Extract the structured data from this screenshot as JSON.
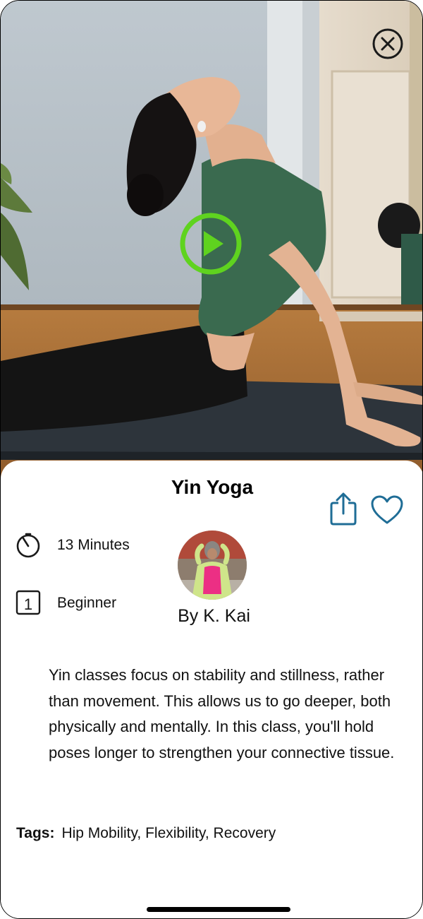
{
  "hero": {
    "close_icon": "close-circle-icon",
    "play_icon": "play-circle-icon",
    "accent_color": "#5fd31f"
  },
  "class": {
    "title": "Yin Yoga",
    "duration": "13 Minutes",
    "level_number": "1",
    "level": "Beginner",
    "instructor": "By K. Kai",
    "description": "Yin classes focus on stability and stillness, rather than movement. This allows us to go deeper, both physically and mentally. In this class, you'll hold poses longer to strengthen your connective tissue.",
    "tags_label": "Tags:",
    "tags": "Hip Mobility, Flexibility, Recovery"
  },
  "actions": {
    "share_icon": "share-icon",
    "favorite_icon": "heart-icon",
    "icon_color": "#1f6d96"
  }
}
